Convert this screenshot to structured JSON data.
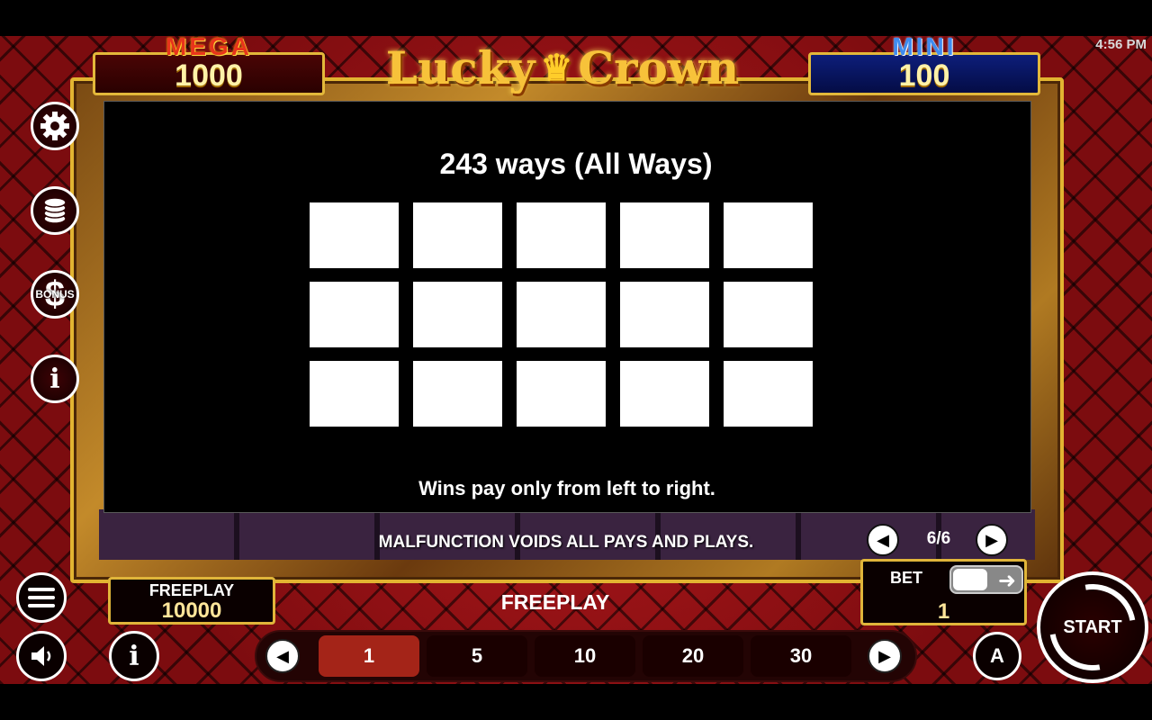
{
  "status_bar": {
    "time": "4:56 PM"
  },
  "jackpots": {
    "mega": {
      "label": "MEGA",
      "value": "1000"
    },
    "mini": {
      "label": "MINI",
      "value": "100"
    }
  },
  "logo": {
    "text_left": "Lucky",
    "text_right": "Crown",
    "icon": "crown-icon"
  },
  "side_menu": [
    {
      "name": "settings",
      "icon": "gear-icon"
    },
    {
      "name": "coins",
      "icon": "coin-stack-icon"
    },
    {
      "name": "bonus",
      "icon": "bonus-dollar-icon",
      "label": "BONUS"
    },
    {
      "name": "info",
      "icon": "info-icon"
    }
  ],
  "paytable": {
    "title": "243 ways (All Ways)",
    "grid": {
      "rows": 3,
      "cols": 5
    },
    "note": "Wins pay only from left to right.",
    "disclaimer": "MALFUNCTION VOIDS ALL PAYS AND PLAYS.",
    "page": "6/6"
  },
  "balance": {
    "label": "FREEPLAY",
    "value": "10000"
  },
  "mode_label": "FREEPLAY",
  "bet": {
    "label": "BET",
    "value": "1"
  },
  "coin_values": [
    "1",
    "5",
    "10",
    "20",
    "30"
  ],
  "selected_coin": "1",
  "buttons": {
    "start": "START",
    "auto": "A"
  }
}
